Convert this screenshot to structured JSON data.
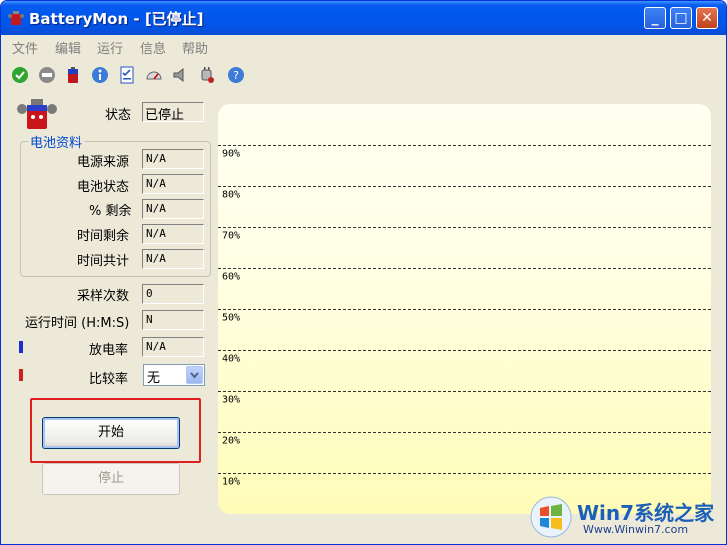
{
  "window": {
    "title": "BatteryMon - [已停止]",
    "minimize_glyph": "_",
    "maximize_glyph": "□",
    "close_glyph": "✕"
  },
  "menu": [
    "文件",
    "编辑",
    "运行",
    "信息",
    "帮助"
  ],
  "toolbar": {
    "icons": [
      "check-icon",
      "stop-icon",
      "battery-icon",
      "info-icon",
      "checklist-icon",
      "gauge-icon",
      "speaker-icon",
      "plug-icon",
      "help-icon"
    ]
  },
  "status": {
    "label": "状态",
    "value": "已停止"
  },
  "battery_info": {
    "title": "电池资料",
    "rows": [
      {
        "label": "电源来源",
        "value": "N/A"
      },
      {
        "label": "电池状态",
        "value": "N/A"
      },
      {
        "label": "% 剩余",
        "value": "N/A"
      },
      {
        "label": "时间剩余",
        "value": "N/A"
      },
      {
        "label": "时间共计",
        "value": "N/A"
      }
    ]
  },
  "samples": {
    "label": "采样次数",
    "value": "0"
  },
  "runtime": {
    "label": "运行时间 (H:M:S)",
    "value": "N"
  },
  "discharge": {
    "label": "放电率",
    "value": "N/A",
    "marker_color": "#1A2FD0"
  },
  "compare": {
    "label": "比较率",
    "selected": "无",
    "marker_color": "#D02020"
  },
  "buttons": {
    "start": "开始",
    "stop": "停止"
  },
  "chart_data": {
    "type": "line",
    "series": [],
    "y_tick_labels": [
      "90%",
      "80%",
      "70%",
      "60%",
      "50%",
      "40%",
      "30%",
      "20%",
      "10%"
    ],
    "ylim": [
      0,
      100
    ],
    "grid": true,
    "background_gradient": [
      "#FFFFF2",
      "#FFFCB8"
    ]
  },
  "watermark": {
    "brand": "Win7系统之家",
    "url": "Www.Winwin7.com"
  }
}
